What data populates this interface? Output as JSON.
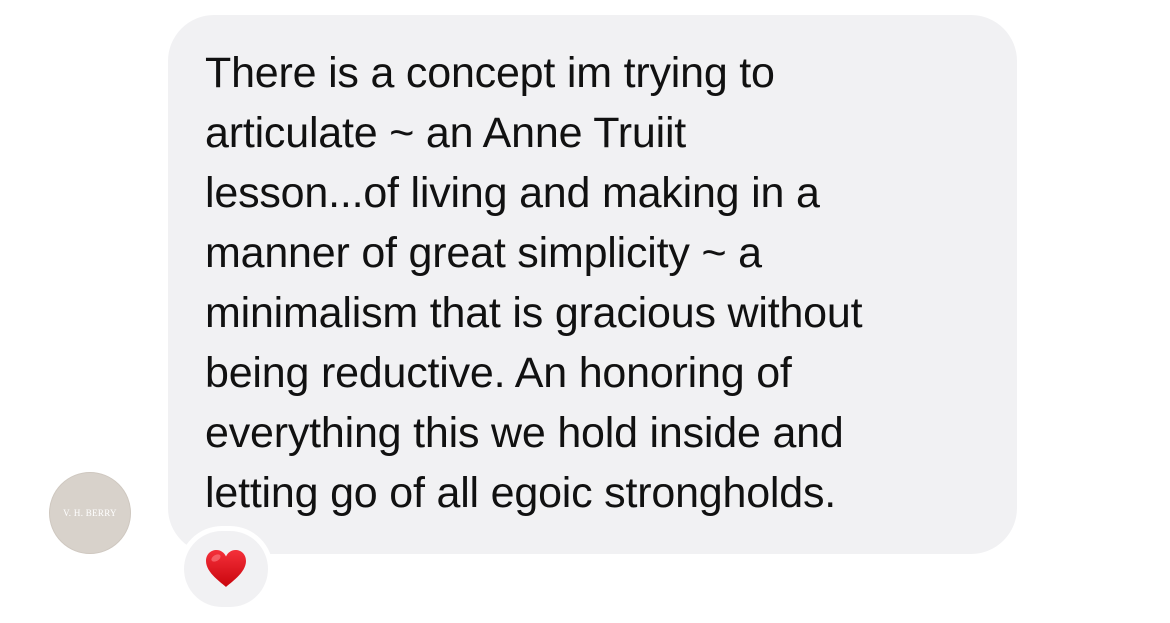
{
  "sender": {
    "avatar_text": "V. H. BERRY"
  },
  "message": {
    "text": "There is a concept im trying to\narticulate ~ an Anne Truiit\nlesson...of living and making in a\nmanner of great simplicity ~ a\nminimalism that is gracious without\nbeing reductive. An honoring of\neverything this we hold inside and\nletting go of all egoic strongholds."
  },
  "reaction": {
    "icon": "red-heart-icon",
    "color": "#e0161c"
  },
  "colors": {
    "bubble": "#f1f1f3",
    "avatar": "#d8d2cb",
    "text": "#111111"
  }
}
